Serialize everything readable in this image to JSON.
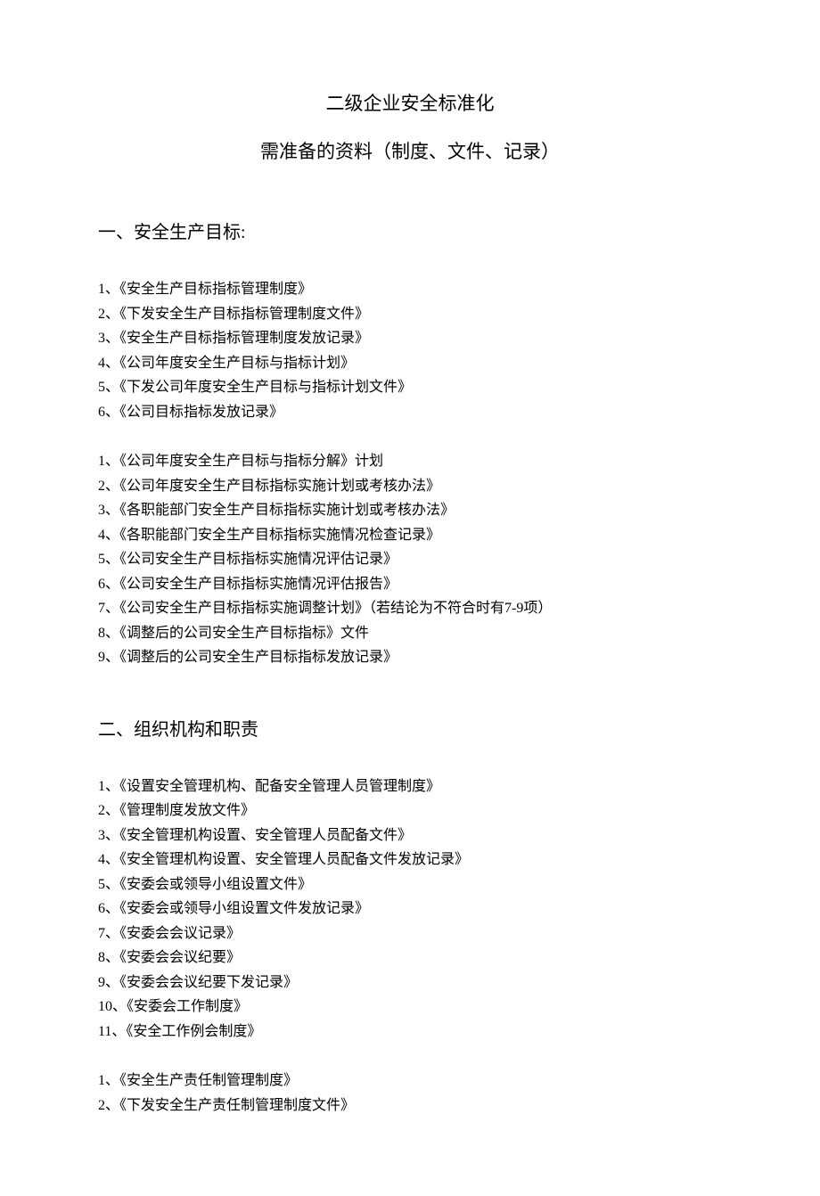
{
  "title_main": "二级企业安全标准化",
  "title_sub": "需准备的资料（制度、文件、记录）",
  "section1": {
    "heading": "一、安全生产目标:",
    "group1": [
      "1、《安全生产目标指标管理制度》",
      "2、《下发安全生产目标指标管理制度文件》",
      "3、《安全生产目标指标管理制度发放记录》",
      "4、《公司年度安全生产目标与指标计划》",
      "5、《下发公司年度安全生产目标与指标计划文件》",
      "6、《公司目标指标发放记录》"
    ],
    "group2": [
      "1、《公司年度安全生产目标与指标分解》计划",
      "2、《公司年度安全生产目标指标实施计划或考核办法》",
      "3、《各职能部门安全生产目标指标实施计划或考核办法》",
      "4、《各职能部门安全生产目标指标实施情况检查记录》",
      "5、《公司安全生产目标指标实施情况评估记录》",
      "6、《公司安全生产目标指标实施情况评估报告》",
      "7、《公司安全生产目标指标实施调整计划》（若结论为不符合时有7-9项）",
      "8、《调整后的公司安全生产目标指标》文件",
      "9、《调整后的公司安全生产目标指标发放记录》"
    ]
  },
  "section2": {
    "heading": "二、组织机构和职责",
    "group1": [
      "1、《设置安全管理机构、配备安全管理人员管理制度》",
      "2、《管理制度发放文件》",
      "3、《安全管理机构设置、安全管理人员配备文件》",
      "4、《安全管理机构设置、安全管理人员配备文件发放记录》",
      "5、《安委会或领导小组设置文件》",
      "6、《安委会或领导小组设置文件发放记录》",
      "7、《安委会会议记录》",
      "8、《安委会会议纪要》",
      "9、《安委会会议纪要下发记录》",
      "10、《安委会工作制度》",
      "11、《安全工作例会制度》"
    ],
    "group2": [
      "1、《安全生产责任制管理制度》",
      "2、《下发安全生产责任制管理制度文件》"
    ]
  }
}
